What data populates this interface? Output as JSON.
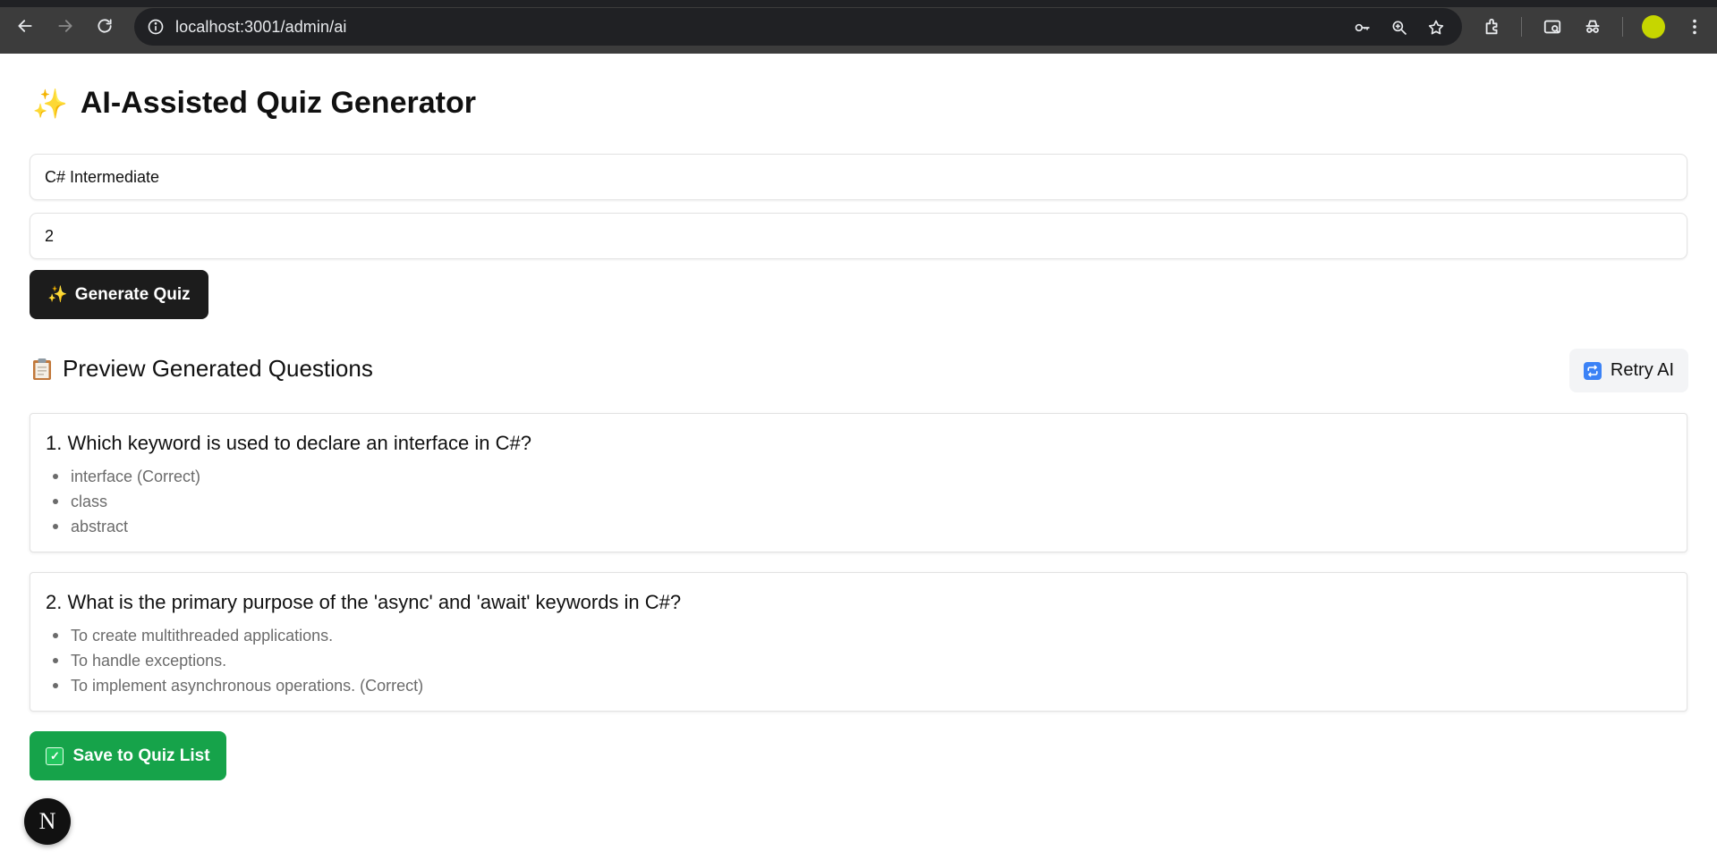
{
  "browser": {
    "url": "localhost:3001/admin/ai",
    "icons": [
      "back-arrow-icon",
      "forward-arrow-icon",
      "reload-icon",
      "site-info-icon",
      "password-key-icon",
      "zoom-icon",
      "bookmark-star-icon",
      "extensions-icon",
      "search-tabs-icon",
      "incognito-icon",
      "profile-avatar",
      "menu-dots-icon"
    ],
    "profile_color": "#c6d600"
  },
  "page": {
    "title_icon": "✨",
    "title": "AI-Assisted Quiz Generator"
  },
  "form": {
    "topic_value": "C# Intermediate",
    "count_value": "2",
    "generate_icon": "✨",
    "generate_label": "Generate Quiz"
  },
  "preview": {
    "title": "Preview Generated Questions",
    "retry_label": "Retry AI",
    "questions": [
      {
        "text": "1. Which keyword is used to declare an interface in C#?",
        "options": [
          "interface (Correct)",
          "class",
          "abstract"
        ]
      },
      {
        "text": "2. What is the primary purpose of the 'async' and 'await' keywords in C#?",
        "options": [
          "To create multithreaded applications.",
          "To handle exceptions.",
          "To implement asynchronous operations. (Correct)"
        ]
      }
    ]
  },
  "actions": {
    "save_label": "Save to Quiz List"
  },
  "badge": {
    "letter": "N"
  },
  "colors": {
    "primary_button": "#1c1c1c",
    "save_button": "#16a34a",
    "retry_button_bg": "#f3f4f6"
  }
}
